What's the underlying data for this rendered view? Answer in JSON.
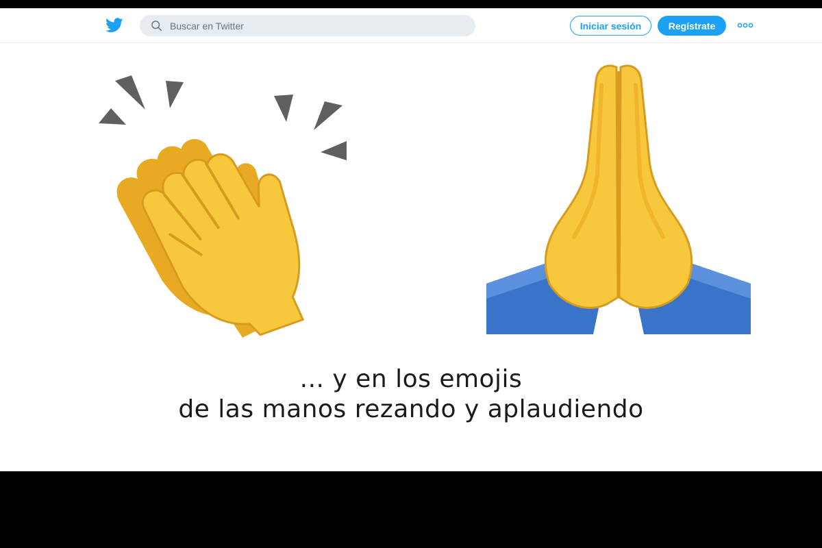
{
  "header": {
    "search": {
      "placeholder": "Buscar en Twitter"
    },
    "login_label": "Iniciar sesión",
    "signup_label": "Regístrate",
    "icons": {
      "logo": "twitter-bird-icon",
      "search": "search-icon",
      "more": "more-dots-icon"
    }
  },
  "content": {
    "left_emoji": "clapping-hands-emoji",
    "right_emoji": "folded-hands-emoji",
    "caption_line1": "... y en los emojis",
    "caption_line2": "de las manos rezando y aplaudiendo"
  },
  "colors": {
    "brand": "#1da1f2",
    "skin": "#f7c83b",
    "sleeve": "#3a74c8",
    "background": "#ffffff",
    "letterbox": "#000000"
  }
}
